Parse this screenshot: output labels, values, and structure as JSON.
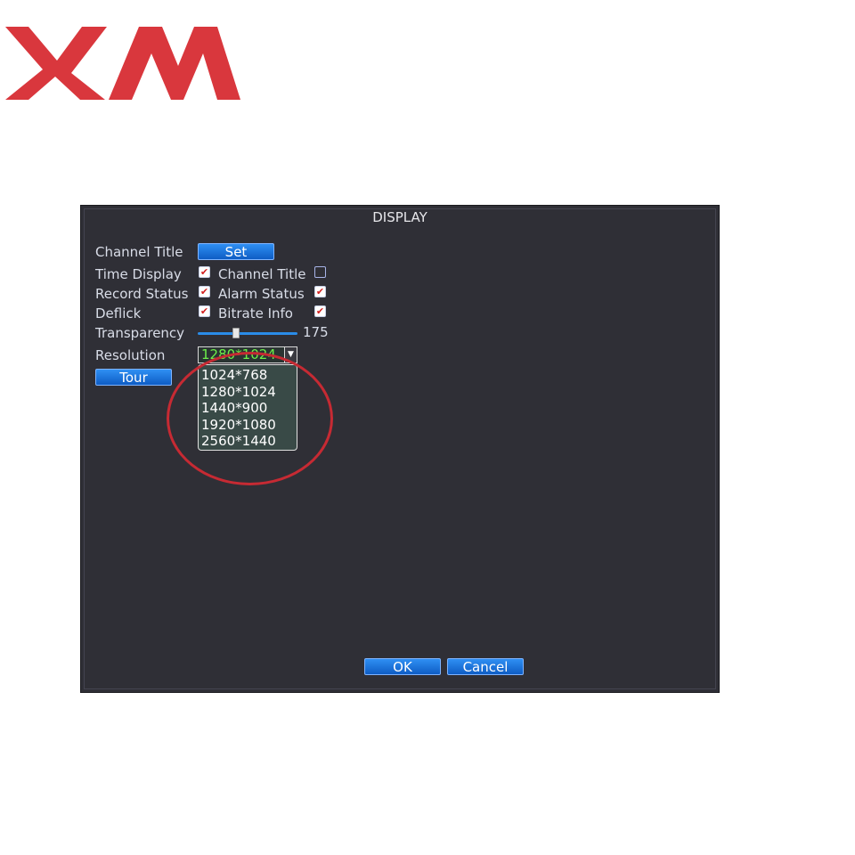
{
  "brand": {
    "logo_text": "XM",
    "color": "#d9373d"
  },
  "dialog": {
    "title": "DISPLAY",
    "channel_title": {
      "label": "Channel Title",
      "button": "Set"
    },
    "time_display": {
      "label": "Time Display",
      "checked": true
    },
    "channel_title_toggle": {
      "label": "Channel Title",
      "checked": false
    },
    "record_status": {
      "label": "Record Status",
      "checked": true
    },
    "alarm_status": {
      "label": "Alarm Status",
      "checked": true
    },
    "deflick": {
      "label": "Deflick",
      "checked": true
    },
    "bitrate_info": {
      "label": "Bitrate Info",
      "checked": true
    },
    "transparency": {
      "label": "Transparency",
      "value": "175",
      "fraction": 0.38
    },
    "resolution": {
      "label": "Resolution",
      "selected": "1280*1024",
      "options": [
        "1024*768",
        "1280*1024",
        "1440*900",
        "1920*1080",
        "2560*1440"
      ]
    },
    "tour_button": "Tour",
    "ok_button": "OK",
    "cancel_button": "Cancel"
  },
  "colors": {
    "dialog_bg": "#2f2f36",
    "button_blue": "#1a6fd8",
    "selected_text": "#6df04a",
    "check_mark": "#d32020",
    "highlight_circle": "#c62a33"
  }
}
